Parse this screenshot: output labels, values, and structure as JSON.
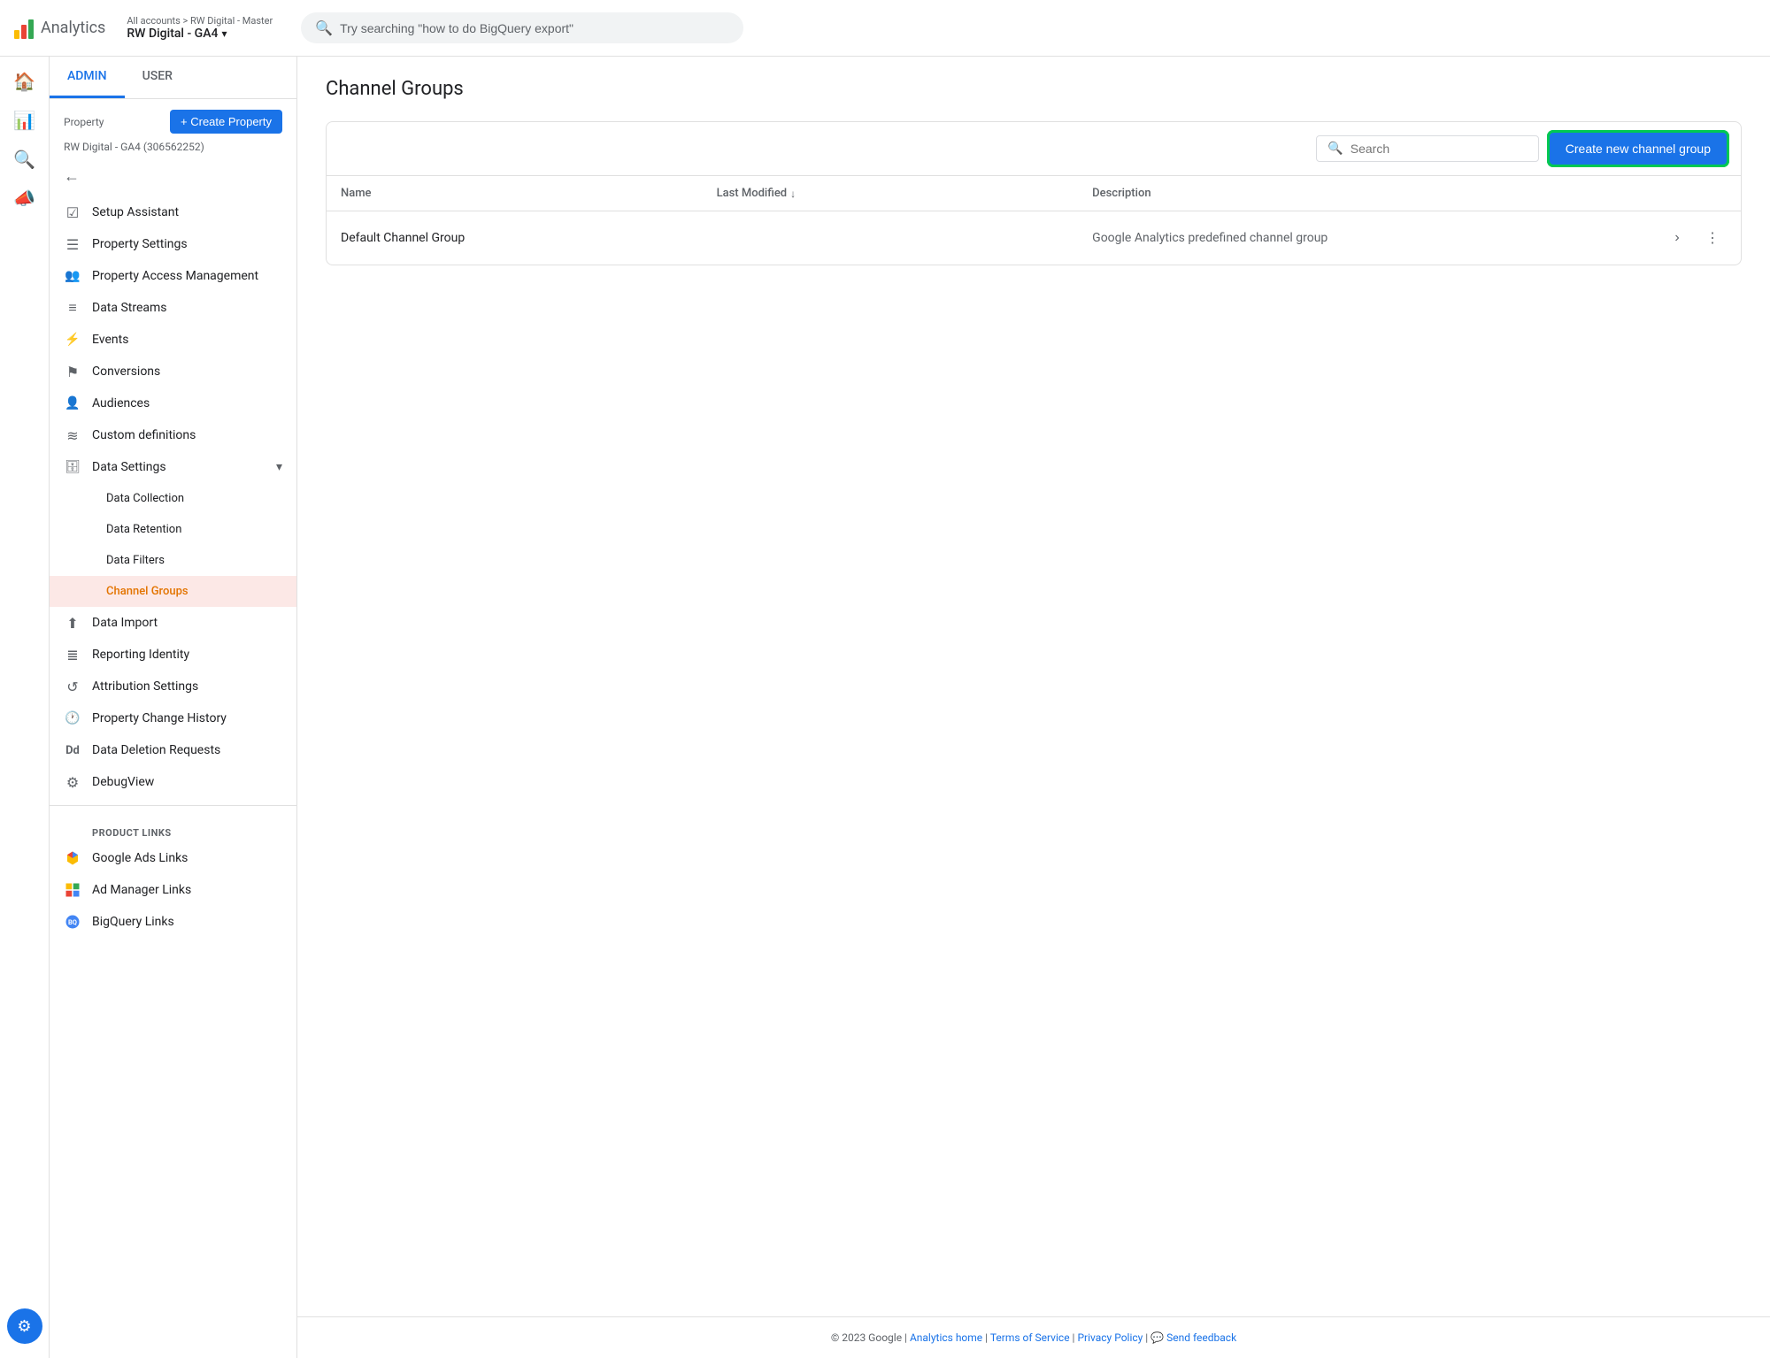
{
  "topbar": {
    "logo_text": "Analytics",
    "account_path": "All accounts > RW Digital - Master",
    "account_name": "RW Digital - GA4",
    "search_placeholder": "Try searching \"how to do BigQuery export\""
  },
  "admin_tabs": [
    {
      "id": "admin",
      "label": "ADMIN",
      "active": true
    },
    {
      "id": "user",
      "label": "USER",
      "active": false
    }
  ],
  "property": {
    "label": "Property",
    "create_btn": "+ Create Property",
    "name": "RW Digital - GA4 (306562252)"
  },
  "nav_items": [
    {
      "id": "setup-assistant",
      "label": "Setup Assistant",
      "icon": "☑"
    },
    {
      "id": "property-settings",
      "label": "Property Settings",
      "icon": "☰"
    },
    {
      "id": "property-access",
      "label": "Property Access Management",
      "icon": "👥"
    },
    {
      "id": "data-streams",
      "label": "Data Streams",
      "icon": "≡"
    },
    {
      "id": "events",
      "label": "Events",
      "icon": "⚡"
    },
    {
      "id": "conversions",
      "label": "Conversions",
      "icon": "⚑"
    },
    {
      "id": "audiences",
      "label": "Audiences",
      "icon": "👤"
    },
    {
      "id": "custom-definitions",
      "label": "Custom definitions",
      "icon": "≋"
    },
    {
      "id": "data-settings",
      "label": "Data Settings",
      "icon": "🗄",
      "expandable": true,
      "expanded": true
    },
    {
      "id": "data-collection",
      "label": "Data Collection",
      "sub": true
    },
    {
      "id": "data-retention",
      "label": "Data Retention",
      "sub": true
    },
    {
      "id": "data-filters",
      "label": "Data Filters",
      "sub": true
    },
    {
      "id": "channel-groups",
      "label": "Channel Groups",
      "sub": true,
      "active": true
    },
    {
      "id": "data-import",
      "label": "Data Import",
      "icon": "⬆"
    },
    {
      "id": "reporting-identity",
      "label": "Reporting Identity",
      "icon": "≣"
    },
    {
      "id": "attribution-settings",
      "label": "Attribution Settings",
      "icon": "↺"
    },
    {
      "id": "property-change-history",
      "label": "Property Change History",
      "icon": "🕐"
    },
    {
      "id": "data-deletion-requests",
      "label": "Data Deletion Requests",
      "icon": "Dd"
    },
    {
      "id": "debug-view",
      "label": "DebugView",
      "icon": "⚙"
    }
  ],
  "product_links": {
    "section_label": "PRODUCT LINKS",
    "items": [
      {
        "id": "google-ads",
        "label": "Google Ads Links",
        "icon": "ads"
      },
      {
        "id": "ad-manager",
        "label": "Ad Manager Links",
        "icon": "adm"
      },
      {
        "id": "bigquery",
        "label": "BigQuery Links",
        "icon": "bq"
      }
    ]
  },
  "page": {
    "title": "Channel Groups"
  },
  "table": {
    "search_placeholder": "Search",
    "create_btn_label": "Create new channel group",
    "columns": [
      {
        "id": "name",
        "label": "Name"
      },
      {
        "id": "last_modified",
        "label": "Last Modified"
      },
      {
        "id": "description",
        "label": "Description"
      }
    ],
    "rows": [
      {
        "name": "Default Channel Group",
        "last_modified": "",
        "description": "Google Analytics predefined channel group"
      }
    ]
  },
  "footer": {
    "copy": "© 2023 Google",
    "links": [
      {
        "label": "Analytics home",
        "url": "#"
      },
      {
        "label": "Terms of Service",
        "url": "#"
      },
      {
        "label": "Privacy Policy",
        "url": "#"
      },
      {
        "label": "Send feedback",
        "url": "#"
      }
    ]
  }
}
